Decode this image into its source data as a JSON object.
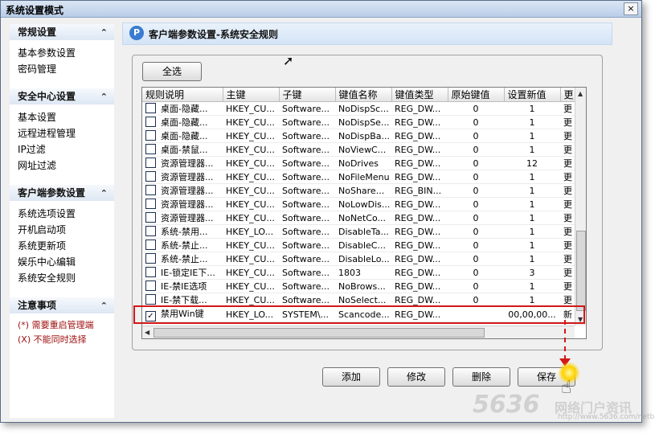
{
  "window": {
    "title": "系统设置模式",
    "close_label": "×"
  },
  "sidebar": {
    "sections": [
      {
        "title": "常规设置",
        "items": [
          "基本参数设置",
          "密码管理"
        ]
      },
      {
        "title": "安全中心设置",
        "items": [
          "基本设置",
          "远程进程管理",
          "IP过滤",
          "网址过滤"
        ]
      },
      {
        "title": "客户端参数设置",
        "items": [
          "系统选项设置",
          "开机启动项",
          "系统更新项",
          "娱乐中心编辑",
          "系统安全规则"
        ]
      },
      {
        "title": "注意事项",
        "notes": [
          "(*) 需要重启管理端",
          "(X) 不能同时选择"
        ]
      }
    ]
  },
  "header": {
    "title": "客户端参数设置-系统安全规则",
    "logo_glyph": "P"
  },
  "buttons": {
    "select_all": "全选",
    "add": "添加",
    "modify": "修改",
    "delete": "删除",
    "save": "保存"
  },
  "table": {
    "columns": [
      "规则说明",
      "主键",
      "子键",
      "键值名称",
      "键值类型",
      "原始键值",
      "设置新值",
      "更"
    ],
    "rows": [
      {
        "checked": false,
        "c": [
          "桌面-隐藏...",
          "HKEY_CU...",
          "Software...",
          "NoDispSc...",
          "REG_DW...",
          "0",
          "1",
          "更"
        ]
      },
      {
        "checked": false,
        "c": [
          "桌面-隐藏...",
          "HKEY_CU...",
          "Software...",
          "NoDispSe...",
          "REG_DW...",
          "0",
          "1",
          "更"
        ]
      },
      {
        "checked": false,
        "c": [
          "桌面-隐藏...",
          "HKEY_CU...",
          "Software...",
          "NoDispBa...",
          "REG_DW...",
          "0",
          "1",
          "更"
        ]
      },
      {
        "checked": false,
        "c": [
          "桌面-禁鼠...",
          "HKEY_CU...",
          "Software...",
          "NoViewC...",
          "REG_DW...",
          "0",
          "1",
          "更"
        ]
      },
      {
        "checked": false,
        "c": [
          "资源管理器...",
          "HKEY_CU...",
          "Software...",
          "NoDrives",
          "REG_DW...",
          "0",
          "12",
          "更"
        ]
      },
      {
        "checked": false,
        "c": [
          "资源管理器...",
          "HKEY_CU...",
          "Software...",
          "NoFileMenu",
          "REG_DW...",
          "0",
          "1",
          "更"
        ]
      },
      {
        "checked": false,
        "c": [
          "资源管理器...",
          "HKEY_CU...",
          "Software...",
          "NoShare...",
          "REG_BIN...",
          "0",
          "1",
          "更"
        ]
      },
      {
        "checked": false,
        "c": [
          "资源管理器...",
          "HKEY_CU...",
          "Software...",
          "NoLowDis...",
          "REG_DW...",
          "0",
          "1",
          "更"
        ]
      },
      {
        "checked": false,
        "c": [
          "资源管理器...",
          "HKEY_CU...",
          "Software...",
          "NoNetCo...",
          "REG_DW...",
          "0",
          "1",
          "更"
        ]
      },
      {
        "checked": false,
        "c": [
          "系统-禁用...",
          "HKEY_LO...",
          "Software...",
          "DisableTa...",
          "REG_DW...",
          "0",
          "1",
          "更"
        ]
      },
      {
        "checked": false,
        "c": [
          "系统-禁止...",
          "HKEY_CU...",
          "Software...",
          "DisableC...",
          "REG_DW...",
          "0",
          "1",
          "更"
        ]
      },
      {
        "checked": false,
        "c": [
          "系统-禁止...",
          "HKEY_CU...",
          "Software...",
          "DisableLo...",
          "REG_DW...",
          "0",
          "1",
          "更"
        ]
      },
      {
        "checked": false,
        "c": [
          "IE-锁定IE下...",
          "HKEY_CU...",
          "Software...",
          "1803",
          "REG_DW...",
          "0",
          "3",
          "更"
        ]
      },
      {
        "checked": false,
        "c": [
          "IE-禁IE选项",
          "HKEY_CU...",
          "Software...",
          "NoBrows...",
          "REG_DW...",
          "0",
          "1",
          "更"
        ]
      },
      {
        "checked": false,
        "c": [
          "IE-禁下载...",
          "HKEY_CU...",
          "Software...",
          "NoSelect...",
          "REG_DW...",
          "0",
          "1",
          "更"
        ]
      },
      {
        "checked": true,
        "c": [
          "禁用Win键",
          "HKEY_LO...",
          "SYSTEM\\...",
          "Scancode...",
          "REG_DW...",
          "",
          "00,00,00...",
          "新"
        ]
      }
    ]
  },
  "watermark": {
    "brand": "5636",
    "cn": "网络门户资讯",
    "url": "http://www.5636.com/netbar/"
  }
}
